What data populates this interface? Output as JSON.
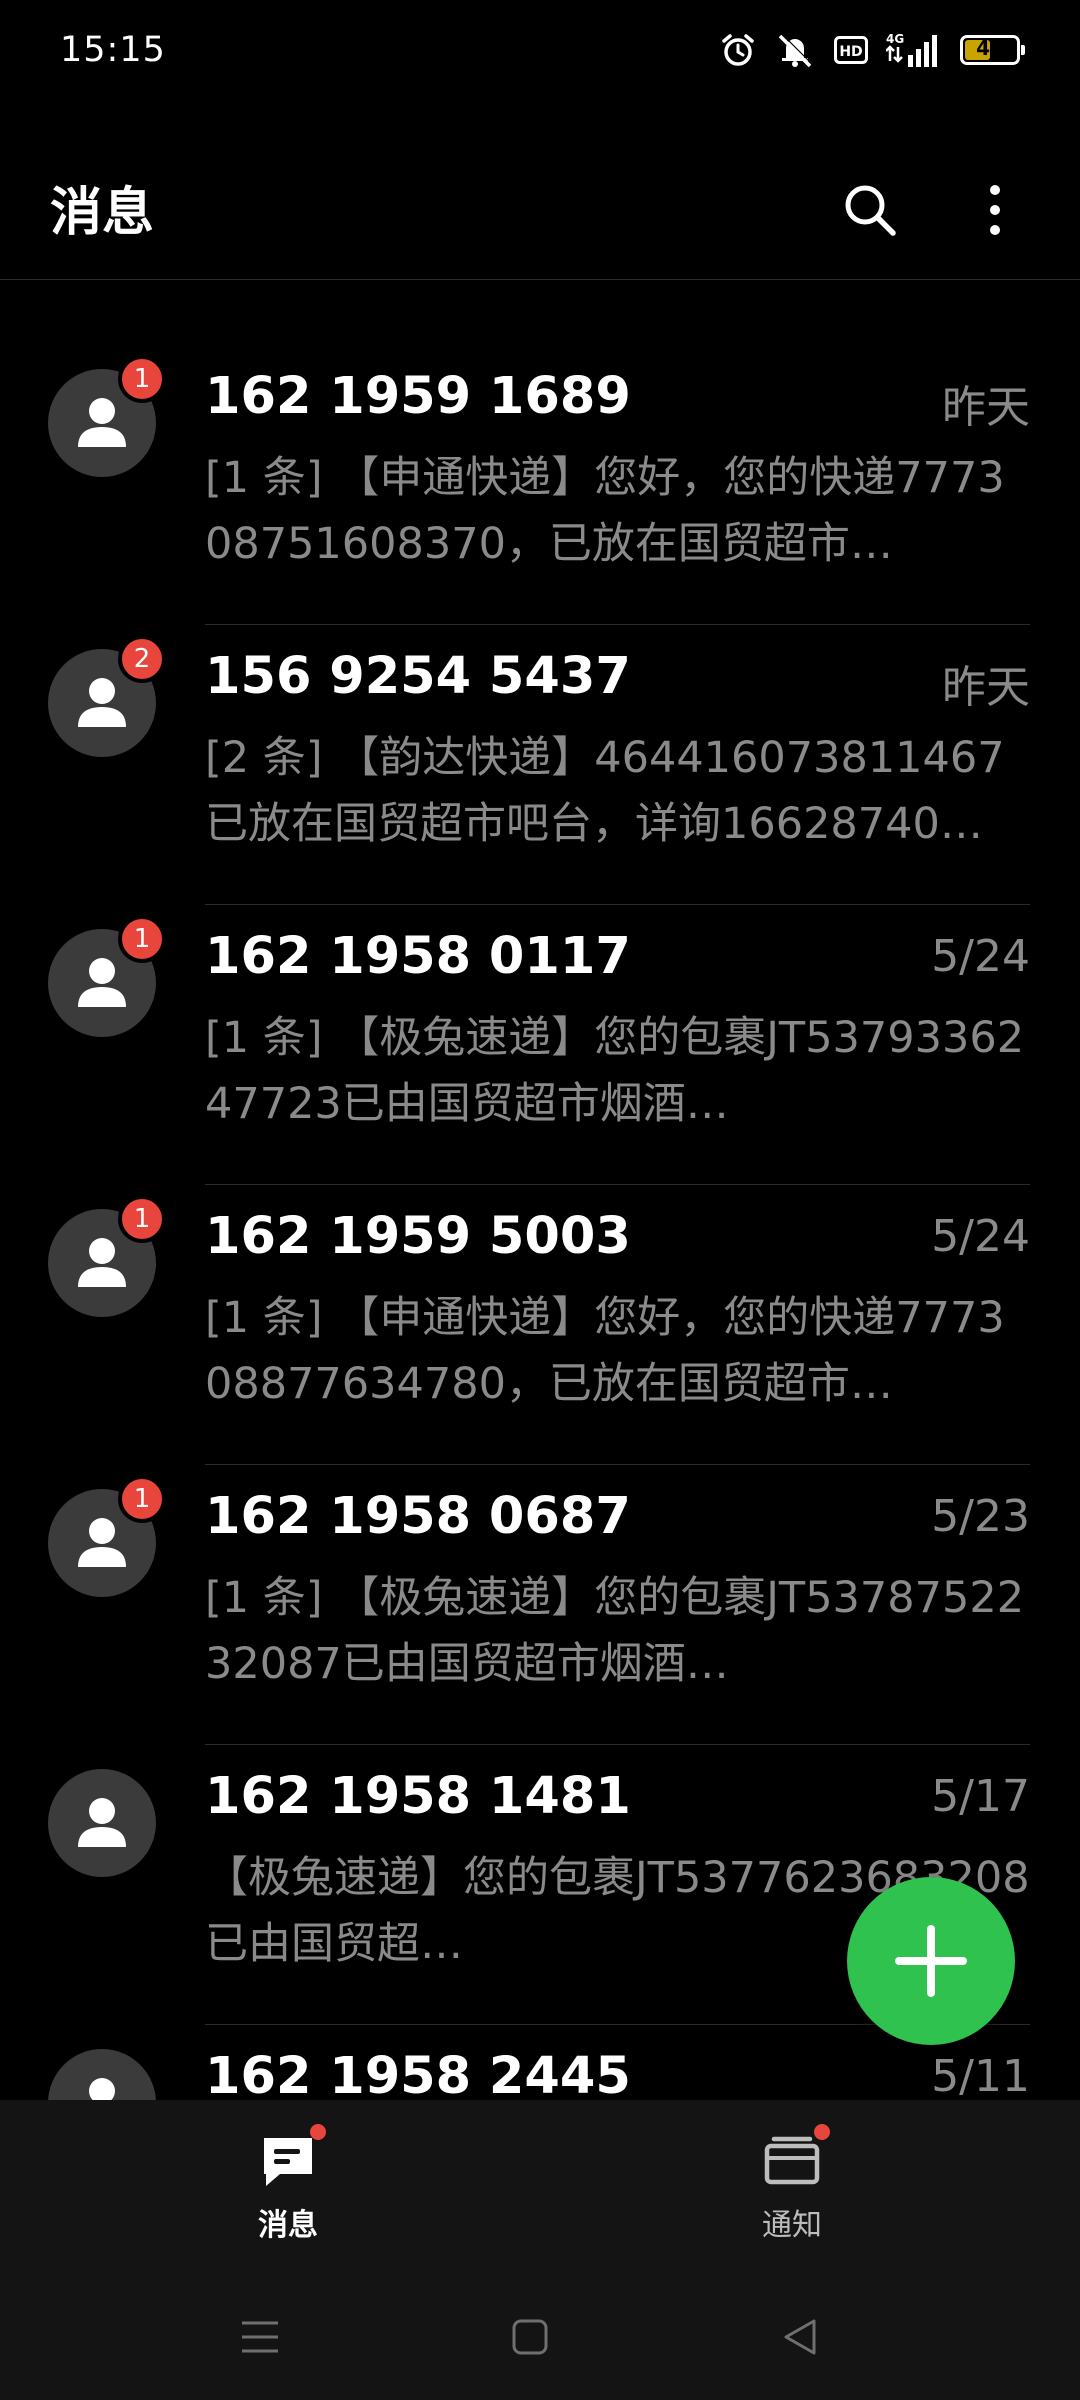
{
  "status_bar": {
    "time": "15:15",
    "battery_level": "47",
    "icons": [
      "alarm-icon",
      "mute-icon",
      "hd-icon",
      "4g-signal-icon",
      "battery-icon"
    ]
  },
  "header": {
    "title": "消息",
    "icons": [
      "search-icon",
      "more-vert-icon"
    ]
  },
  "conversations": [
    {
      "name": "162 1959 1689",
      "date": "昨天",
      "unread": "1",
      "preview": "[1 条] 【申通快递】您好，您的快递777308751608370，已放在国贸超市…"
    },
    {
      "name": "156 9254 5437",
      "date": "昨天",
      "unread": "2",
      "preview": "[2 条] 【韵达快递】464416073811467已放在国贸超市吧台，详询16628740…"
    },
    {
      "name": "162 1958 0117",
      "date": "5/24",
      "unread": "1",
      "preview": "[1 条] 【极兔速递】您的包裹JT5379336247723已由国贸超市烟酒…"
    },
    {
      "name": "162 1959 5003",
      "date": "5/24",
      "unread": "1",
      "preview": "[1 条] 【申通快递】您好，您的快递777308877634780，已放在国贸超市…"
    },
    {
      "name": "162 1958 0687",
      "date": "5/23",
      "unread": "1",
      "preview": "[1 条] 【极兔速递】您的包裹JT5378752232087已由国贸超市烟酒…"
    },
    {
      "name": "162 1958 1481",
      "date": "5/17",
      "unread": null,
      "preview": "【极兔速递】您的包裹JT5377623683208已由国贸超…"
    },
    {
      "name": "162 1958 2445",
      "date": "5/11",
      "unread": null,
      "preview": ""
    }
  ],
  "tabs": [
    {
      "label": "消息",
      "icon": "message-icon",
      "active": true,
      "has_dot": true
    },
    {
      "label": "通知",
      "icon": "notification-icon",
      "active": false,
      "has_dot": true
    }
  ],
  "colors": {
    "background": "#000000",
    "accent_green": "#2fc24f",
    "badge_red": "#e8453c",
    "secondary_text": "#8a8a8a"
  }
}
